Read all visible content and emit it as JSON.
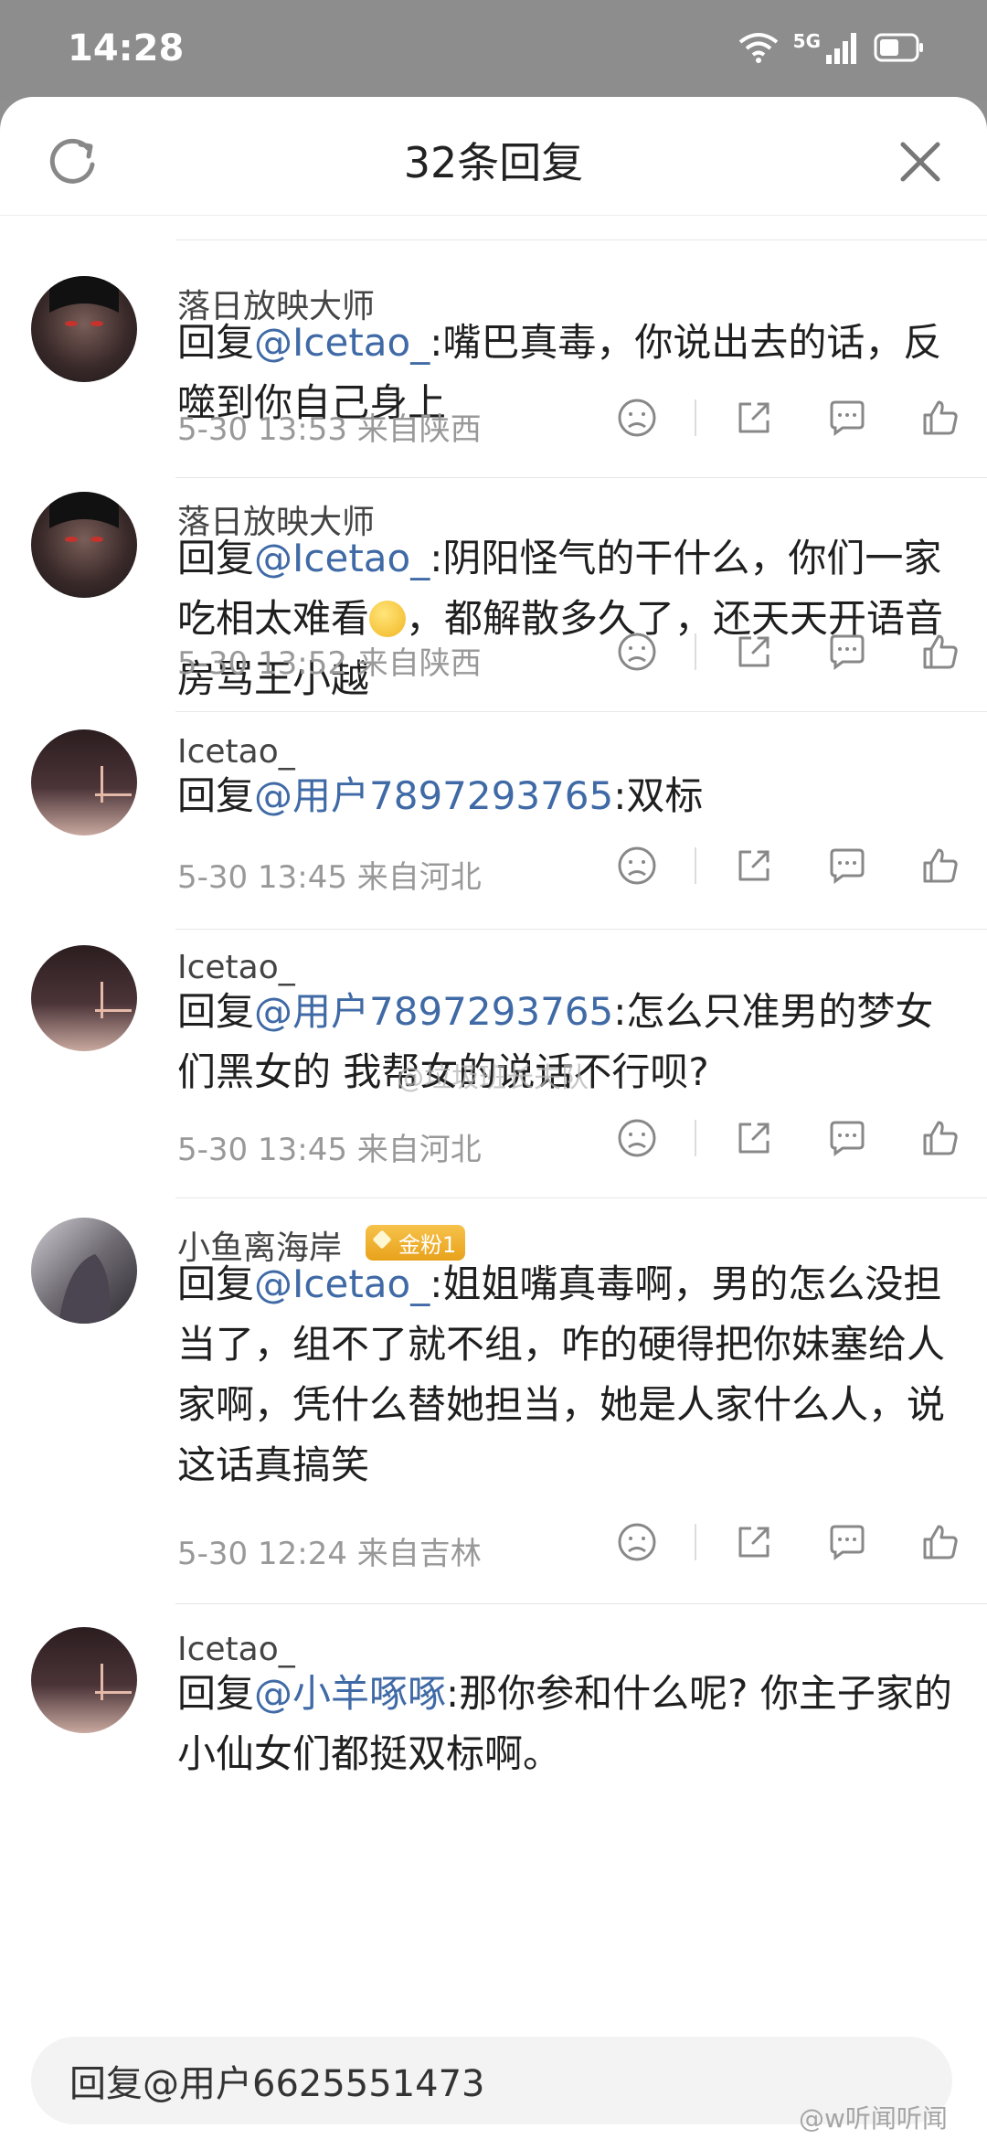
{
  "status_bar": {
    "time": "14:28",
    "network": "5G"
  },
  "header": {
    "title": "32条回复"
  },
  "comments": [
    {
      "user": "落日放映大师",
      "reply_prefix": "回复",
      "mention": "@Icetao_",
      "text": ":嘴巴真毒，你说出去的话，反噬到你自己身上",
      "date": "5-30 13:53",
      "location": "来自陕西"
    },
    {
      "user": "落日放映大师",
      "reply_prefix": "回复",
      "mention": "@Icetao_",
      "text_before_emoji": ":阴阳怪气的干什么，你们一家吃相太难看",
      "text_after_emoji": "，都解散多久了，还天天开语音房骂王小越",
      "date": "5-30 13:52",
      "location": "来自陕西"
    },
    {
      "user": "Icetao_",
      "reply_prefix": "回复",
      "mention": "@用户7897293765",
      "text": ":双标",
      "date": "5-30 13:45",
      "location": "来自河北"
    },
    {
      "user": "Icetao_",
      "reply_prefix": "回复",
      "mention": "@用户7897293765",
      "text": ":怎么只准男的梦女们黑女的 我帮女的说话不行呗?",
      "date": "5-30 13:45",
      "location": "来自河北"
    },
    {
      "user": "小鱼离海岸",
      "badge": "金粉1",
      "reply_prefix": "回复",
      "mention": "@Icetao_",
      "text": ":姐姐嘴真毒啊，男的怎么没担当了，组不了就不组，咋的硬得把你妹塞给人家啊，凭什么替她担当，她是人家什么人，说这话真搞笑",
      "date": "5-30 12:24",
      "location": "来自吉林"
    },
    {
      "user": "Icetao_",
      "reply_prefix": "回复",
      "mention": "@小羊啄啄",
      "text": ":那你参和什么呢? 你主子家的小仙女们都挺双标啊。"
    }
  ],
  "reply_input": {
    "value": "回复@用户6625551473"
  },
  "watermarks": {
    "mid": "@垃圾班长夫队",
    "bottom": "@w听闻听闻"
  },
  "colors": {
    "mention": "#3f6aa6",
    "badge": "#f0b12c"
  }
}
